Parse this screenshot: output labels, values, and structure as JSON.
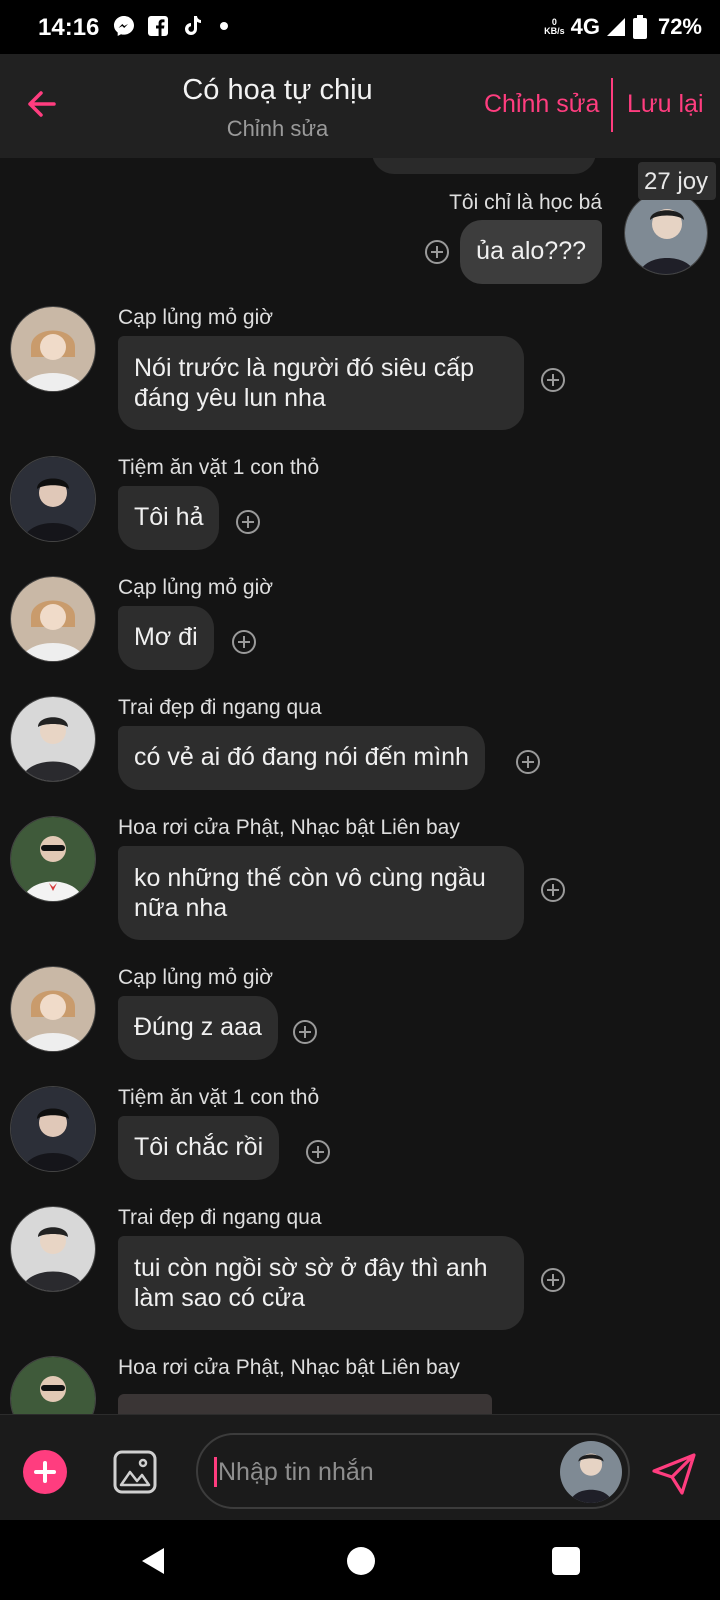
{
  "status_bar": {
    "time": "14:16",
    "notification_icons": [
      "messenger-icon",
      "facebook-icon",
      "tiktok-icon",
      "dot-icon"
    ],
    "net_speed_value": "0",
    "net_speed_unit": "KB/s",
    "network": "4G",
    "battery": "72%"
  },
  "header": {
    "title": "Có hoạ tự chịu",
    "subtitle": "Chỉnh sửa",
    "edit_label": "Chỉnh sửa",
    "save_label": "Lưu lại",
    "accent_color": "#ff3d7f"
  },
  "chat": {
    "badge": "27 joy",
    "self_message": {
      "sender": "Tôi chỉ là học bá",
      "text": "ủa alo???"
    },
    "messages": [
      {
        "sender": "Cạp lủng mỏ giờ",
        "text": "Nói trước là người đó siêu cấp đáng yêu lun nha"
      },
      {
        "sender": "Tiệm ăn vặt 1 con thỏ",
        "text": "Tôi hả"
      },
      {
        "sender": "Cạp lủng mỏ giờ",
        "text": "Mơ đi"
      },
      {
        "sender": "Trai đẹp đi ngang qua",
        "text": "có vẻ ai đó đang nói đến mình"
      },
      {
        "sender": "Hoa rơi cửa Phật, Nhạc bật Liên bay",
        "text": "ko những thế còn vô cùng ngầu nữa nha"
      },
      {
        "sender": "Cạp lủng mỏ giờ",
        "text": "Đúng z aaa"
      },
      {
        "sender": "Tiệm ăn vặt 1 con thỏ",
        "text": "Tôi chắc rồi"
      },
      {
        "sender": "Trai đẹp đi ngang qua",
        "text": "tui còn ngồi sờ sờ ở đây thì anh làm sao có cửa"
      },
      {
        "sender": "Hoa rơi cửa Phật, Nhạc bật Liên bay",
        "text": ""
      }
    ]
  },
  "input": {
    "placeholder": "Nhập tin nhắn",
    "value": ""
  }
}
